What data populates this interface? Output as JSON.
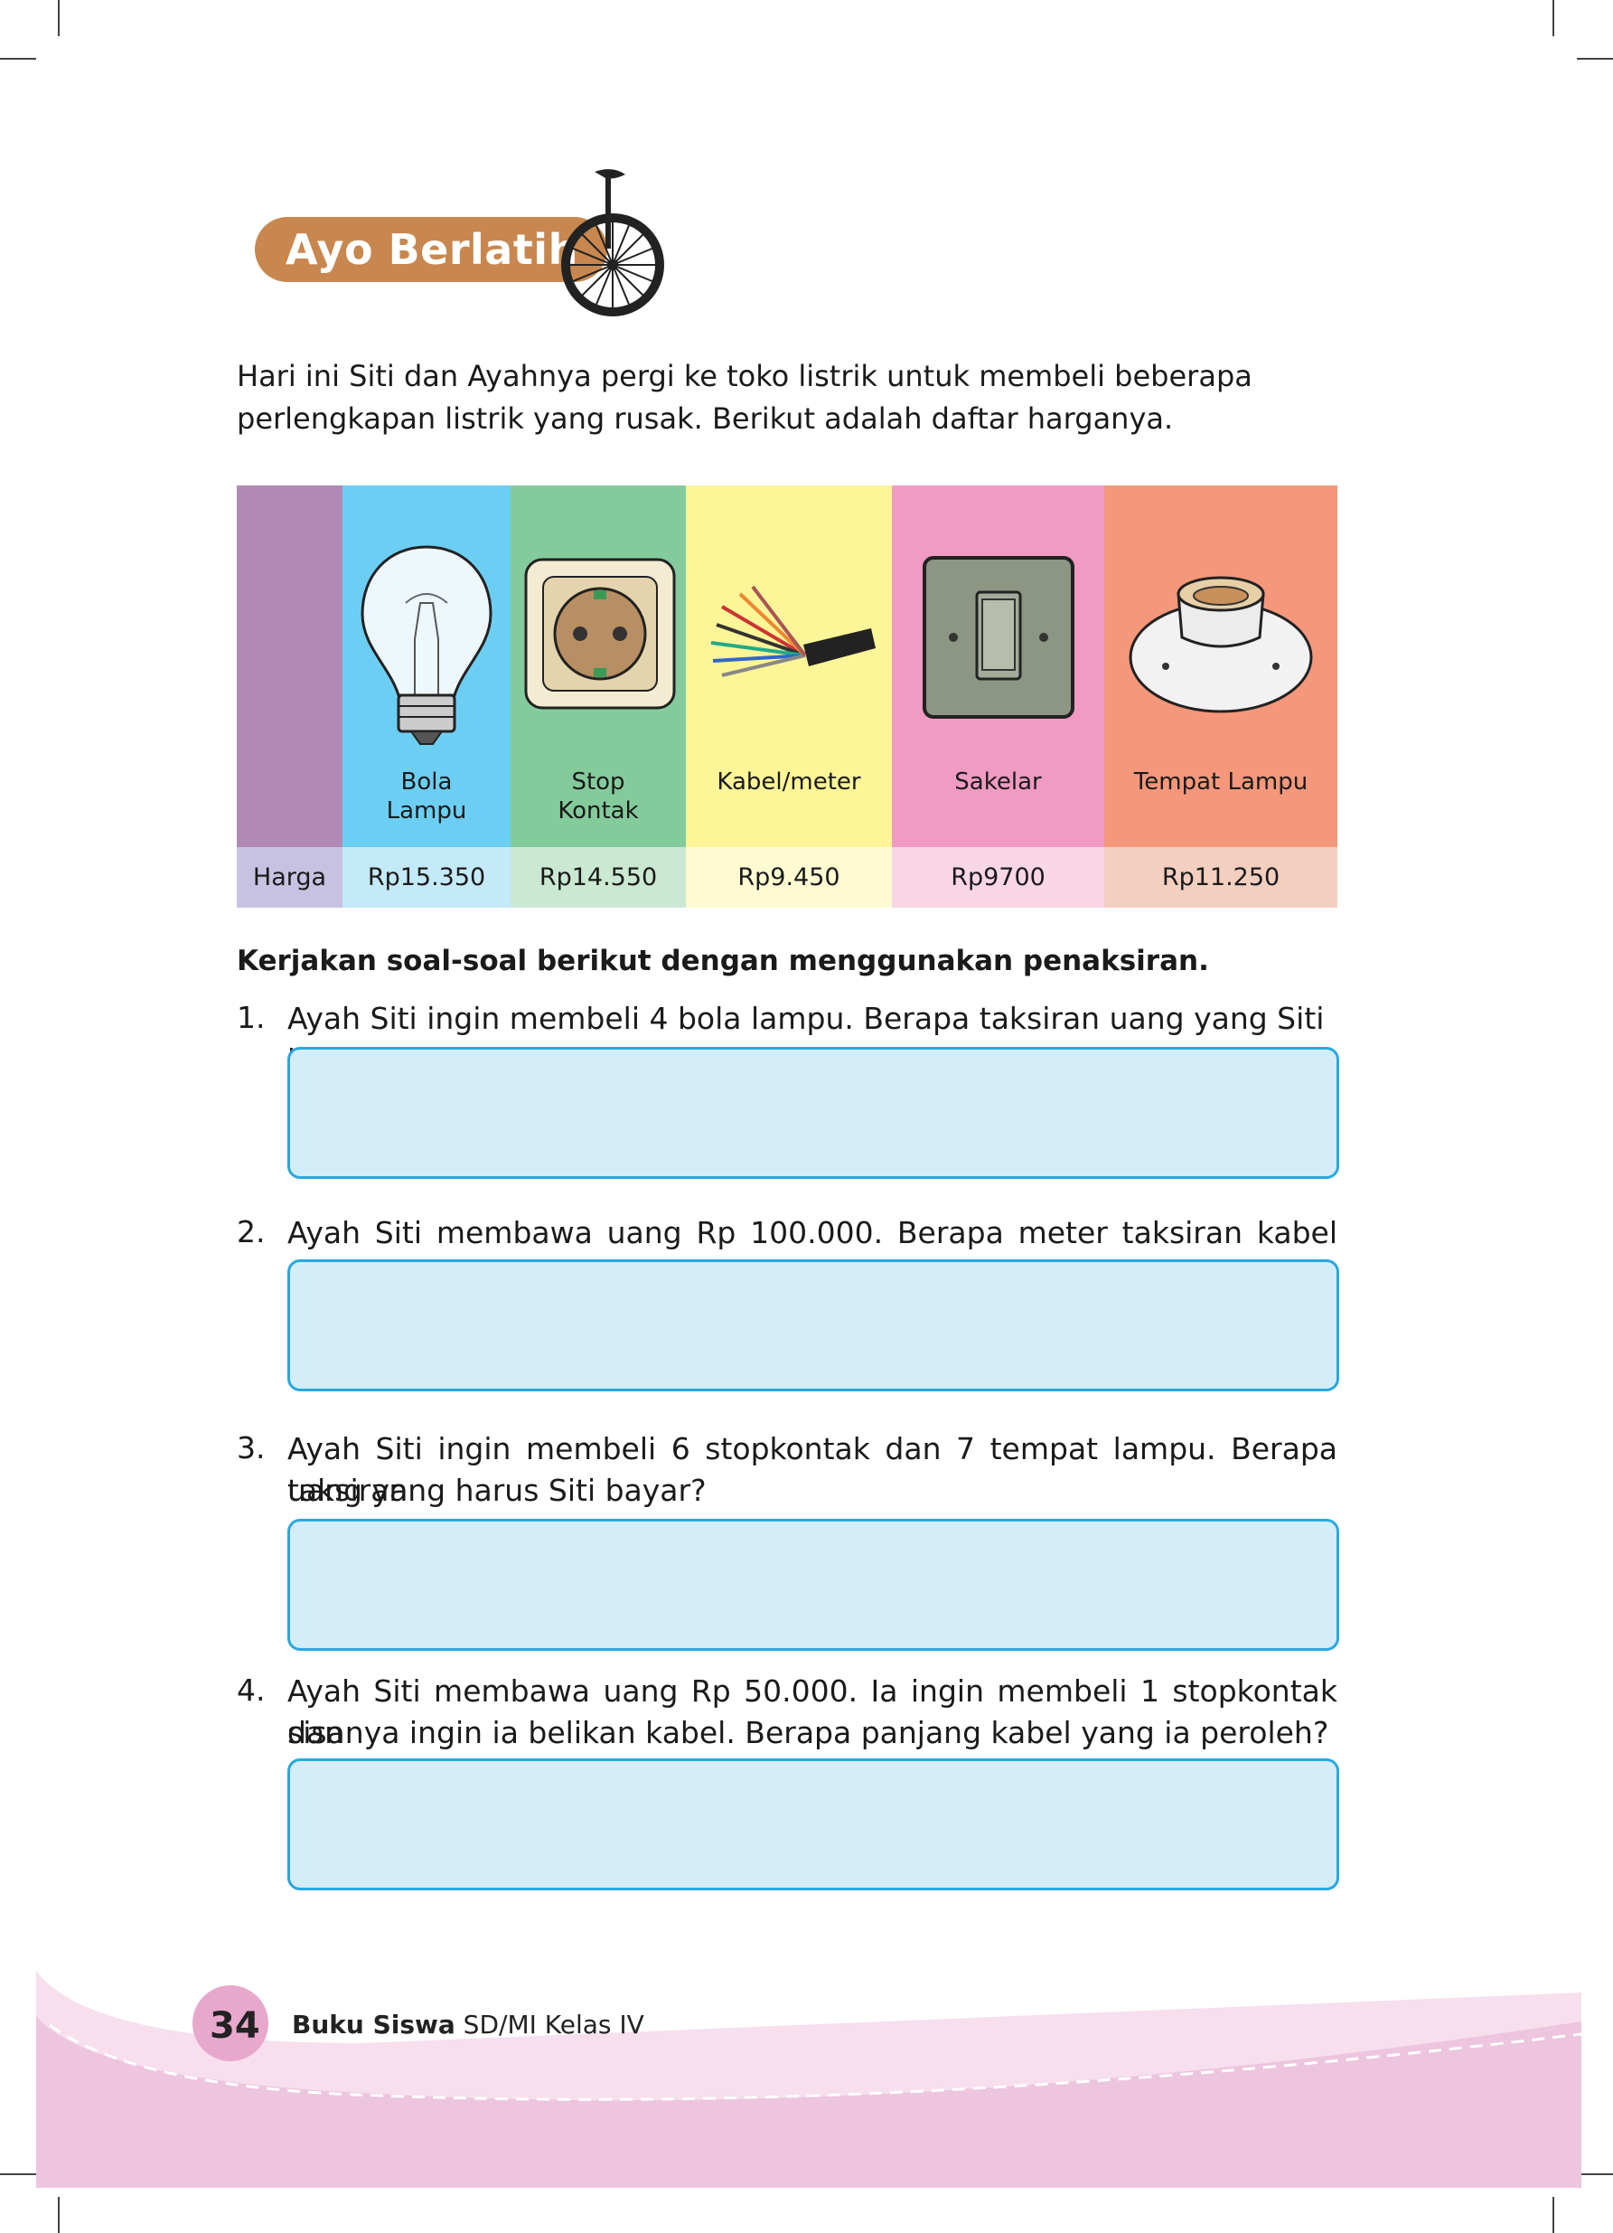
{
  "header": {
    "title": "Ayo Berlatih"
  },
  "intro": {
    "line1": "Hari ini Siti dan Ayahnya pergi ke toko listrik untuk membeli beberapa",
    "line2": "perlengkapan listrik yang rusak. Berikut adalah daftar harganya."
  },
  "price_table": {
    "row_label": "Harga",
    "items": [
      {
        "name_line1": "Bola",
        "name_line2": "Lampu",
        "price": "Rp15.350",
        "icon": "light-bulb-icon"
      },
      {
        "name_line1": "Stop",
        "name_line2": "Kontak",
        "price": "Rp14.550",
        "icon": "wall-socket-icon"
      },
      {
        "name_line1": "Kabel/meter",
        "name_line2": "",
        "price": "Rp9.450",
        "icon": "cable-icon"
      },
      {
        "name_line1": "Sakelar",
        "name_line2": "",
        "price": "Rp9700",
        "icon": "light-switch-icon"
      },
      {
        "name_line1": "Tempat Lampu",
        "name_line2": "",
        "price": "Rp11.250",
        "icon": "lamp-holder-icon"
      }
    ]
  },
  "instruction": "Kerjakan soal-soal berikut dengan menggunakan penaksiran.",
  "questions": [
    {
      "number": "1.",
      "line1": "Ayah Siti ingin membeli 4 bola lampu. Berapa taksiran uang yang Siti bayar?",
      "line2": ""
    },
    {
      "number": "2.",
      "line1": "Ayah Siti membawa uang Rp 100.000. Berapa meter taksiran kabel yang",
      "line2": ""
    },
    {
      "number": "3.",
      "line1": "Ayah Siti ingin membeli 6 stopkontak dan 7 tempat lampu. Berapa taksiran",
      "line2": "uang yang harus Siti bayar?"
    },
    {
      "number": "4.",
      "line1": "Ayah Siti membawa uang Rp 50.000. Ia ingin membeli 1 stopkontak dan",
      "line2": "sisanya ingin ia belikan kabel. Berapa panjang kabel yang ia peroleh?"
    }
  ],
  "footer": {
    "page_number": "34",
    "book_bold": "Buku Siswa",
    "book_rest": " SD/MI Kelas IV"
  },
  "colors": {
    "banner": "#c8874e",
    "answer_fill": "#d3edf9",
    "answer_border": "#29a8e0",
    "col_purple": "#b08ab4",
    "col_blue": "#6dcef3",
    "col_green": "#84cb9b",
    "col_yellow": "#fdf597",
    "col_pink": "#f19ac3",
    "col_salmon": "#f5977b",
    "footer_pink": "#edc5de"
  }
}
